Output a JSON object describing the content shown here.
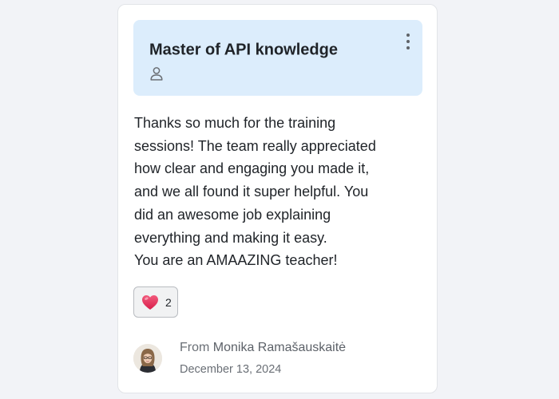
{
  "card": {
    "title": "Master of API knowledge",
    "icons": {
      "owner": "user-outline-icon",
      "menu": "more-vertical-icon",
      "reaction": "heart-icon"
    },
    "message_lines": [
      "Thanks so much for the training",
      "sessions! The team really appreciated",
      "how clear and engaging you made it,",
      "and we all found it super helpful. You",
      "did an awesome job explaining",
      "everything and making it easy.",
      "You are an AMAAZING teacher!"
    ],
    "reaction": {
      "emoji": "heart",
      "count": "2"
    },
    "sender": {
      "prefix": "From",
      "name": "Monika Ramašauskaitė"
    },
    "date": "December 13, 2024"
  },
  "colors": {
    "header_background": "#dcedfc",
    "heart": "#e8365f",
    "text": "#1f2328",
    "muted_text": "#6a6f76"
  }
}
